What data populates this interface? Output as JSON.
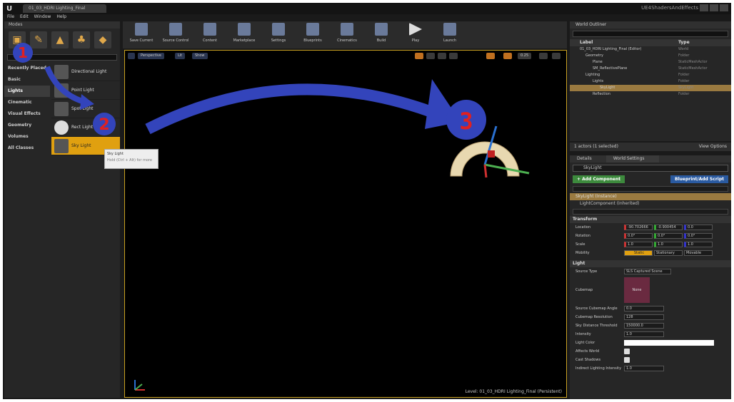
{
  "window": {
    "doc_tab": "01_03_HDRI Lighting_Final",
    "right_title": "UE4ShadersAndEffects",
    "menu": [
      "File",
      "Edit",
      "Window",
      "Help"
    ]
  },
  "modes": {
    "title": "Modes",
    "categories": [
      "Recently Placed",
      "Basic",
      "Lights",
      "Cinematic",
      "Visual Effects",
      "Geometry",
      "Volumes",
      "All Classes"
    ],
    "items": [
      "Directional Light",
      "Point Light",
      "Spot Light",
      "Rect Light",
      "Sky Light"
    ],
    "tooltip_title": "Sky Light",
    "tooltip_hint": "Hold (Ctrl + Alt) for more"
  },
  "annotations": {
    "one": "1",
    "two": "2",
    "three": "3"
  },
  "toolbar": [
    "Save Current",
    "Source Control",
    "Content",
    "Marketplace",
    "Settings",
    "Blueprints",
    "Cinematics",
    "Build",
    "Play",
    "Launch"
  ],
  "viewport": {
    "perspective": "Perspective",
    "lit": "Lit",
    "show": "Show",
    "level": "Level: 01_03_HDRI Lighting_Final (Persistent)",
    "grid_value": "0.25"
  },
  "outliner": {
    "tab": "World Outliner",
    "col_label": "Label",
    "col_type": "Type",
    "rows": [
      {
        "label": "01_03_HDRI Lighting_Final (Editor)",
        "type": "World"
      },
      {
        "label": "Geometry",
        "type": "Folder"
      },
      {
        "label": "Plane",
        "type": "StaticMeshActor"
      },
      {
        "label": "SM_ReflectivePlane",
        "type": "StaticMeshActor"
      },
      {
        "label": "Lighting",
        "type": "Folder"
      },
      {
        "label": "Lights",
        "type": "Folder"
      },
      {
        "label": "SkyLight",
        "type": "SkyLight"
      },
      {
        "label": "Reflection",
        "type": "Folder"
      }
    ],
    "actors_selected": "1 actors (1 selected)",
    "view_options": "View Options"
  },
  "details": {
    "tab_details": "Details",
    "tab_world": "World Settings",
    "name": "SkyLight",
    "add_component": "+ Add Component",
    "blueprint": "Blueprint/Add Script",
    "components": [
      "SkyLight (Instance)",
      "LightComponent (Inherited)"
    ],
    "transform_section": "Transform",
    "location": {
      "label": "Location",
      "x": "-90.702666",
      "y": "-0.900454",
      "z": "0.0"
    },
    "rotation": {
      "label": "Rotation",
      "x": "0.0°",
      "y": "0.0°",
      "z": "0.0°"
    },
    "scale": {
      "label": "Scale",
      "x": "1.0",
      "y": "1.0",
      "z": "1.0"
    },
    "mobility": {
      "label": "Mobility",
      "static": "Static",
      "stationary": "Stationary",
      "movable": "Movable"
    },
    "light_section": "Light",
    "source_type": {
      "label": "Source Type",
      "value": "SLS Captured Scene"
    },
    "cubemap": {
      "label": "Cubemap",
      "value": "None"
    },
    "props": [
      {
        "label": "Source Cubemap Angle",
        "value": "0.0"
      },
      {
        "label": "Cubemap Resolution",
        "value": "128"
      },
      {
        "label": "Sky Distance Threshold",
        "value": "150000.0"
      },
      {
        "label": "Intensity",
        "value": "1.0"
      },
      {
        "label": "Light Color",
        "value": ""
      },
      {
        "label": "Affects World",
        "value": ""
      },
      {
        "label": "Cast Shadows",
        "value": ""
      },
      {
        "label": "Indirect Lighting Intensity",
        "value": "1.0"
      }
    ]
  }
}
